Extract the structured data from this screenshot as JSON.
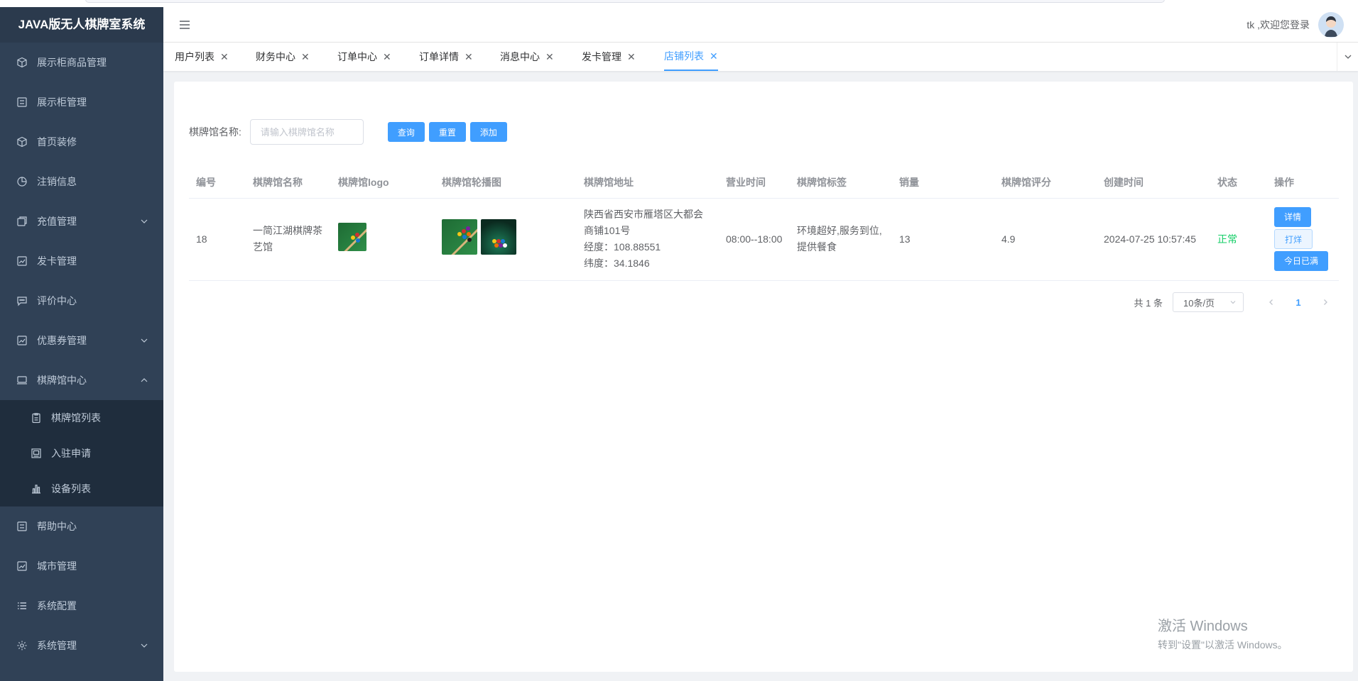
{
  "app": {
    "title": "JAVA版无人棋牌室系统"
  },
  "sidebar": {
    "items": [
      {
        "label": "展示柜商品管理",
        "icon": "cube-icon"
      },
      {
        "label": "展示柜管理",
        "icon": "list-box-icon"
      },
      {
        "label": "首页装修",
        "icon": "cube-icon"
      },
      {
        "label": "注销信息",
        "icon": "pie-chart-icon"
      },
      {
        "label": "充值管理",
        "icon": "copy-icon",
        "expandable": true
      },
      {
        "label": "发卡管理",
        "icon": "trend-icon"
      },
      {
        "label": "评价中心",
        "icon": "chat-icon"
      },
      {
        "label": "优惠券管理",
        "icon": "trend-icon",
        "expandable": true
      },
      {
        "label": "棋牌馆中心",
        "icon": "monitor-icon",
        "expanded": true
      }
    ],
    "sub_items": [
      {
        "label": "棋牌馆列表",
        "icon": "clipboard-icon"
      },
      {
        "label": "入驻申请",
        "icon": "image-icon"
      },
      {
        "label": "设备列表",
        "icon": "bar-chart-icon"
      }
    ],
    "items_after": [
      {
        "label": "帮助中心",
        "icon": "list-box-icon"
      },
      {
        "label": "城市管理",
        "icon": "trend-icon"
      },
      {
        "label": "系统配置",
        "icon": "list-icon"
      },
      {
        "label": "系统管理",
        "icon": "gear-icon",
        "expandable": true
      }
    ]
  },
  "header": {
    "user_text": "tk ,欢迎您登录"
  },
  "tabs": [
    {
      "label": "用户列表"
    },
    {
      "label": "财务中心"
    },
    {
      "label": "订单中心"
    },
    {
      "label": "订单详情"
    },
    {
      "label": "消息中心"
    },
    {
      "label": "发卡管理"
    },
    {
      "label": "店铺列表",
      "active": true
    }
  ],
  "search": {
    "label": "棋牌馆名称:",
    "placeholder": "请输入棋牌馆名称",
    "query_label": "查询",
    "reset_label": "重置",
    "add_label": "添加"
  },
  "table": {
    "columns": [
      "编号",
      "棋牌馆名称",
      "棋牌馆logo",
      "棋牌馆轮播图",
      "棋牌馆地址",
      "营业时间",
      "棋牌馆标签",
      "销量",
      "棋牌馆评分",
      "创建时间",
      "状态",
      "操作"
    ],
    "rows": [
      {
        "id": "18",
        "name": "一简江湖棋牌茶艺馆",
        "address_line1": "陕西省西安市雁塔区大都会商铺101号",
        "longitude": "经度：108.88551",
        "latitude": "纬度：34.1846",
        "hours": "08:00--18:00",
        "tags": "环境超好,服务到位,提供餐食",
        "sales": "13",
        "rating": "4.9",
        "created": "2024-07-25 10:57:45",
        "status": "正常",
        "actions": {
          "detail": "详情",
          "close": "打烊",
          "full": "今日已满"
        }
      }
    ]
  },
  "pagination": {
    "total_text": "共 1 条",
    "page_size": "10条/页",
    "current_page": "1"
  },
  "watermark": {
    "line1": "激活 Windows",
    "line2": "转到\"设置\"以激活 Windows。"
  },
  "colors": {
    "sidebar_bg": "#304156",
    "accent": "#409eff",
    "status_ok": "#13ce66"
  }
}
